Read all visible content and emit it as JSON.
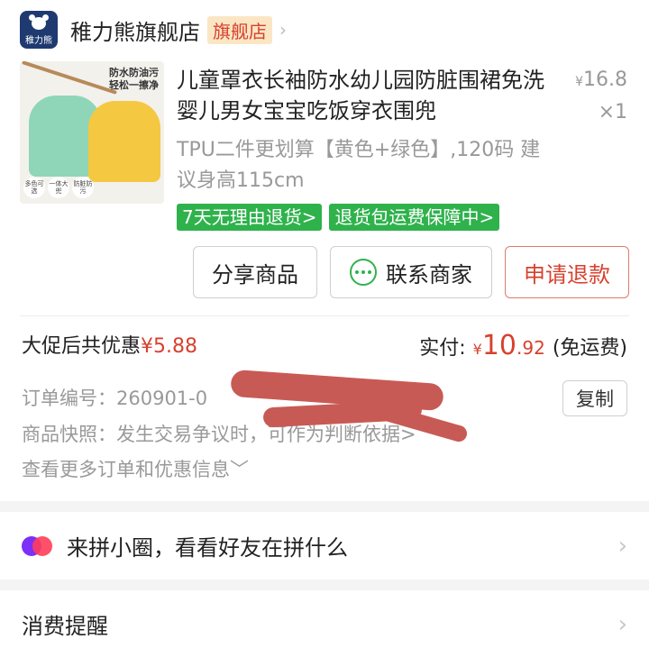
{
  "store": {
    "logo_text": "稚力熊",
    "name": "稚力熊旗舰店",
    "badge": "旗舰店",
    "chevron_icon": "chevron-right-icon"
  },
  "product": {
    "image_headline": [
      "防水防油污",
      "轻松一擦净"
    ],
    "image_tags": [
      "多色可选",
      "一体大兜",
      "防脏防污"
    ],
    "title": "儿童罩衣长袖防水幼儿园防脏围裙免洗婴儿男女宝宝吃饭穿衣围兜",
    "price_symbol": "¥",
    "price": "16.8",
    "quantity": "×1",
    "variant": "TPU二件更划算【黄色+绿色】,120码 建议身高115cm",
    "service_tags": [
      "7天无理由退货>",
      "退货包运费保障中>"
    ]
  },
  "actions": {
    "share": "分享商品",
    "contact": "联系商家",
    "refund": "申请退款"
  },
  "summary": {
    "discount_label": "大促后共优惠",
    "discount_amount": "¥5.88",
    "paid_label": "实付:",
    "paid_symbol": "¥",
    "paid_int": "10",
    "paid_dec": ".92",
    "paid_note": "(免运费)"
  },
  "order": {
    "order_no": "订单编号：260901-0",
    "copy": "复制",
    "snapshot": "商品快照：发生交易争议时，可作为判断依据>",
    "more": "查看更多订单和优惠信息﹀"
  },
  "rows": {
    "pin_circle": "来拼小圈，看看好友在拼什么",
    "reminder": "消费提醒"
  },
  "colors": {
    "accent_red": "#d7412f",
    "service_green": "#2fb24c",
    "redaction": "#c85a55"
  }
}
